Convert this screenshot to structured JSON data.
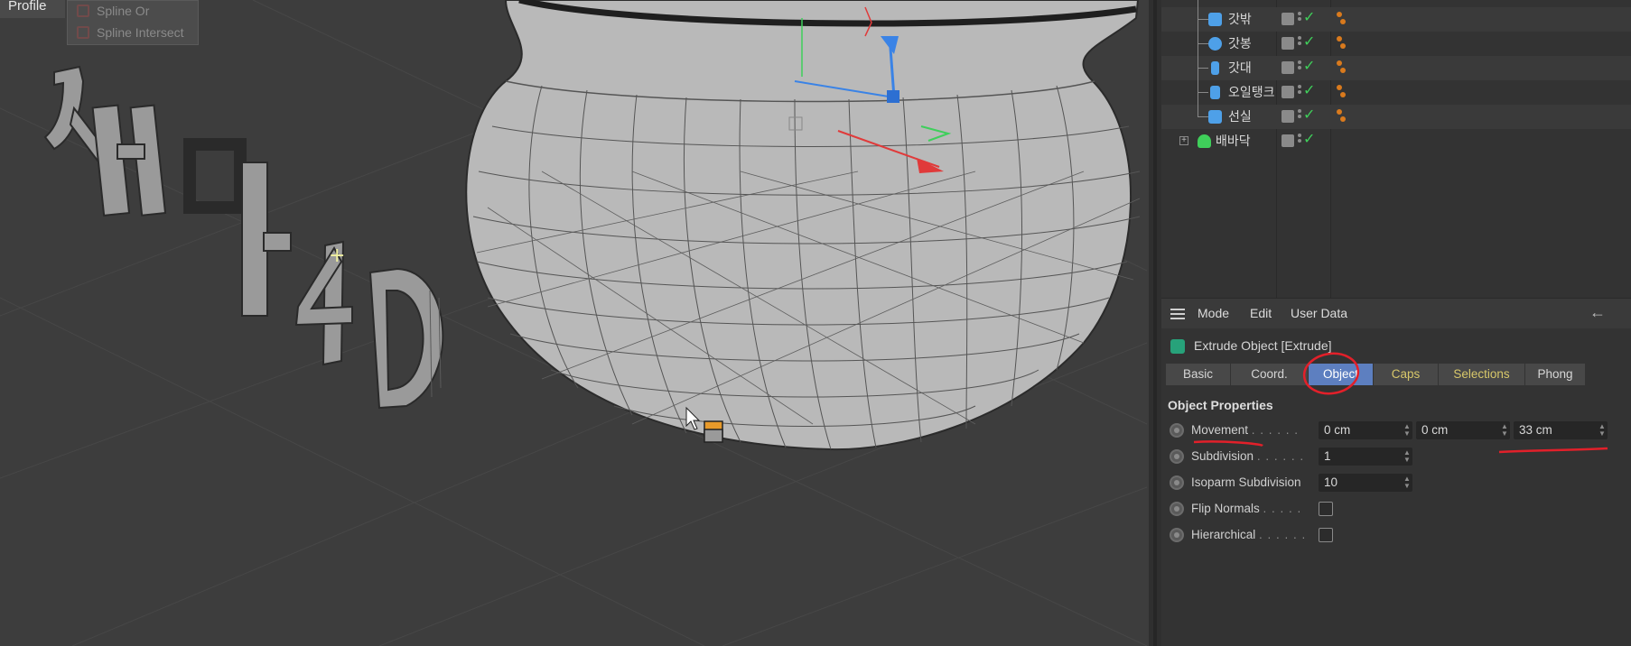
{
  "menu": {
    "profile": "Profile"
  },
  "popup": {
    "items": [
      "Spline Or",
      "Spline Intersect"
    ]
  },
  "viewport": {
    "logo_text": "시네마 4D"
  },
  "objects": [
    {
      "name": "갓밖",
      "icon_color": "#4ea0e8"
    },
    {
      "name": "갓봉",
      "icon_color": "#4ea0e8"
    },
    {
      "name": "갓대",
      "icon_color": "#4ea0e8"
    },
    {
      "name": "오일탱크",
      "icon_color": "#4ea0e8"
    },
    {
      "name": "선실",
      "icon_color": "#4ea0e8"
    },
    {
      "name": "배바닥",
      "icon_color": "#3fcf5a"
    }
  ],
  "attr": {
    "menu": {
      "mode": "Mode",
      "edit": "Edit",
      "user_data": "User Data"
    },
    "title": "Extrude Object [Extrude]",
    "tabs": [
      "Basic",
      "Coord.",
      "Object",
      "Caps",
      "Selections",
      "Phong"
    ],
    "active_tab": "Object",
    "section": "Object Properties",
    "props": {
      "movement": {
        "label": "Movement",
        "x": "0 cm",
        "y": "0 cm",
        "z": "33 cm"
      },
      "subdivision": {
        "label": "Subdivision",
        "value": "1"
      },
      "isoparm": {
        "label": "Isoparm Subdivision",
        "value": "10"
      },
      "flip_normals": {
        "label": "Flip Normals",
        "checked": false
      },
      "hierarchical": {
        "label": "Hierarchical",
        "checked": false
      }
    }
  },
  "colors": {
    "accent": "#5d7fc0",
    "annotation": "#e2202a",
    "check": "#3fcf5a"
  }
}
